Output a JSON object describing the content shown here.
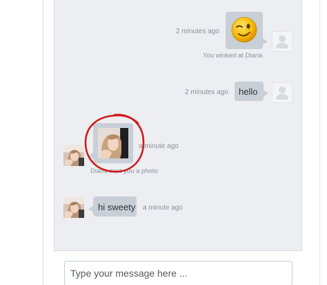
{
  "messages": [
    {
      "type": "wink",
      "direction": "sent",
      "time": "2 minutes ago",
      "note": "You winked at Diana"
    },
    {
      "type": "text",
      "direction": "sent",
      "time": "2 minutes ago",
      "text": "hello"
    },
    {
      "type": "photo",
      "direction": "received",
      "time": "a minute ago",
      "note": "Diana sent you a photo"
    },
    {
      "type": "text",
      "direction": "received",
      "time": "a minute ago",
      "text": "hi sweety"
    }
  ],
  "composer": {
    "placeholder": "Type your message here ..."
  },
  "colors": {
    "panel_bg": "#eceef1",
    "bubble_bg": "#c9cfd6",
    "annotation": "#d11a1a",
    "wink_face": "#f5b800"
  }
}
